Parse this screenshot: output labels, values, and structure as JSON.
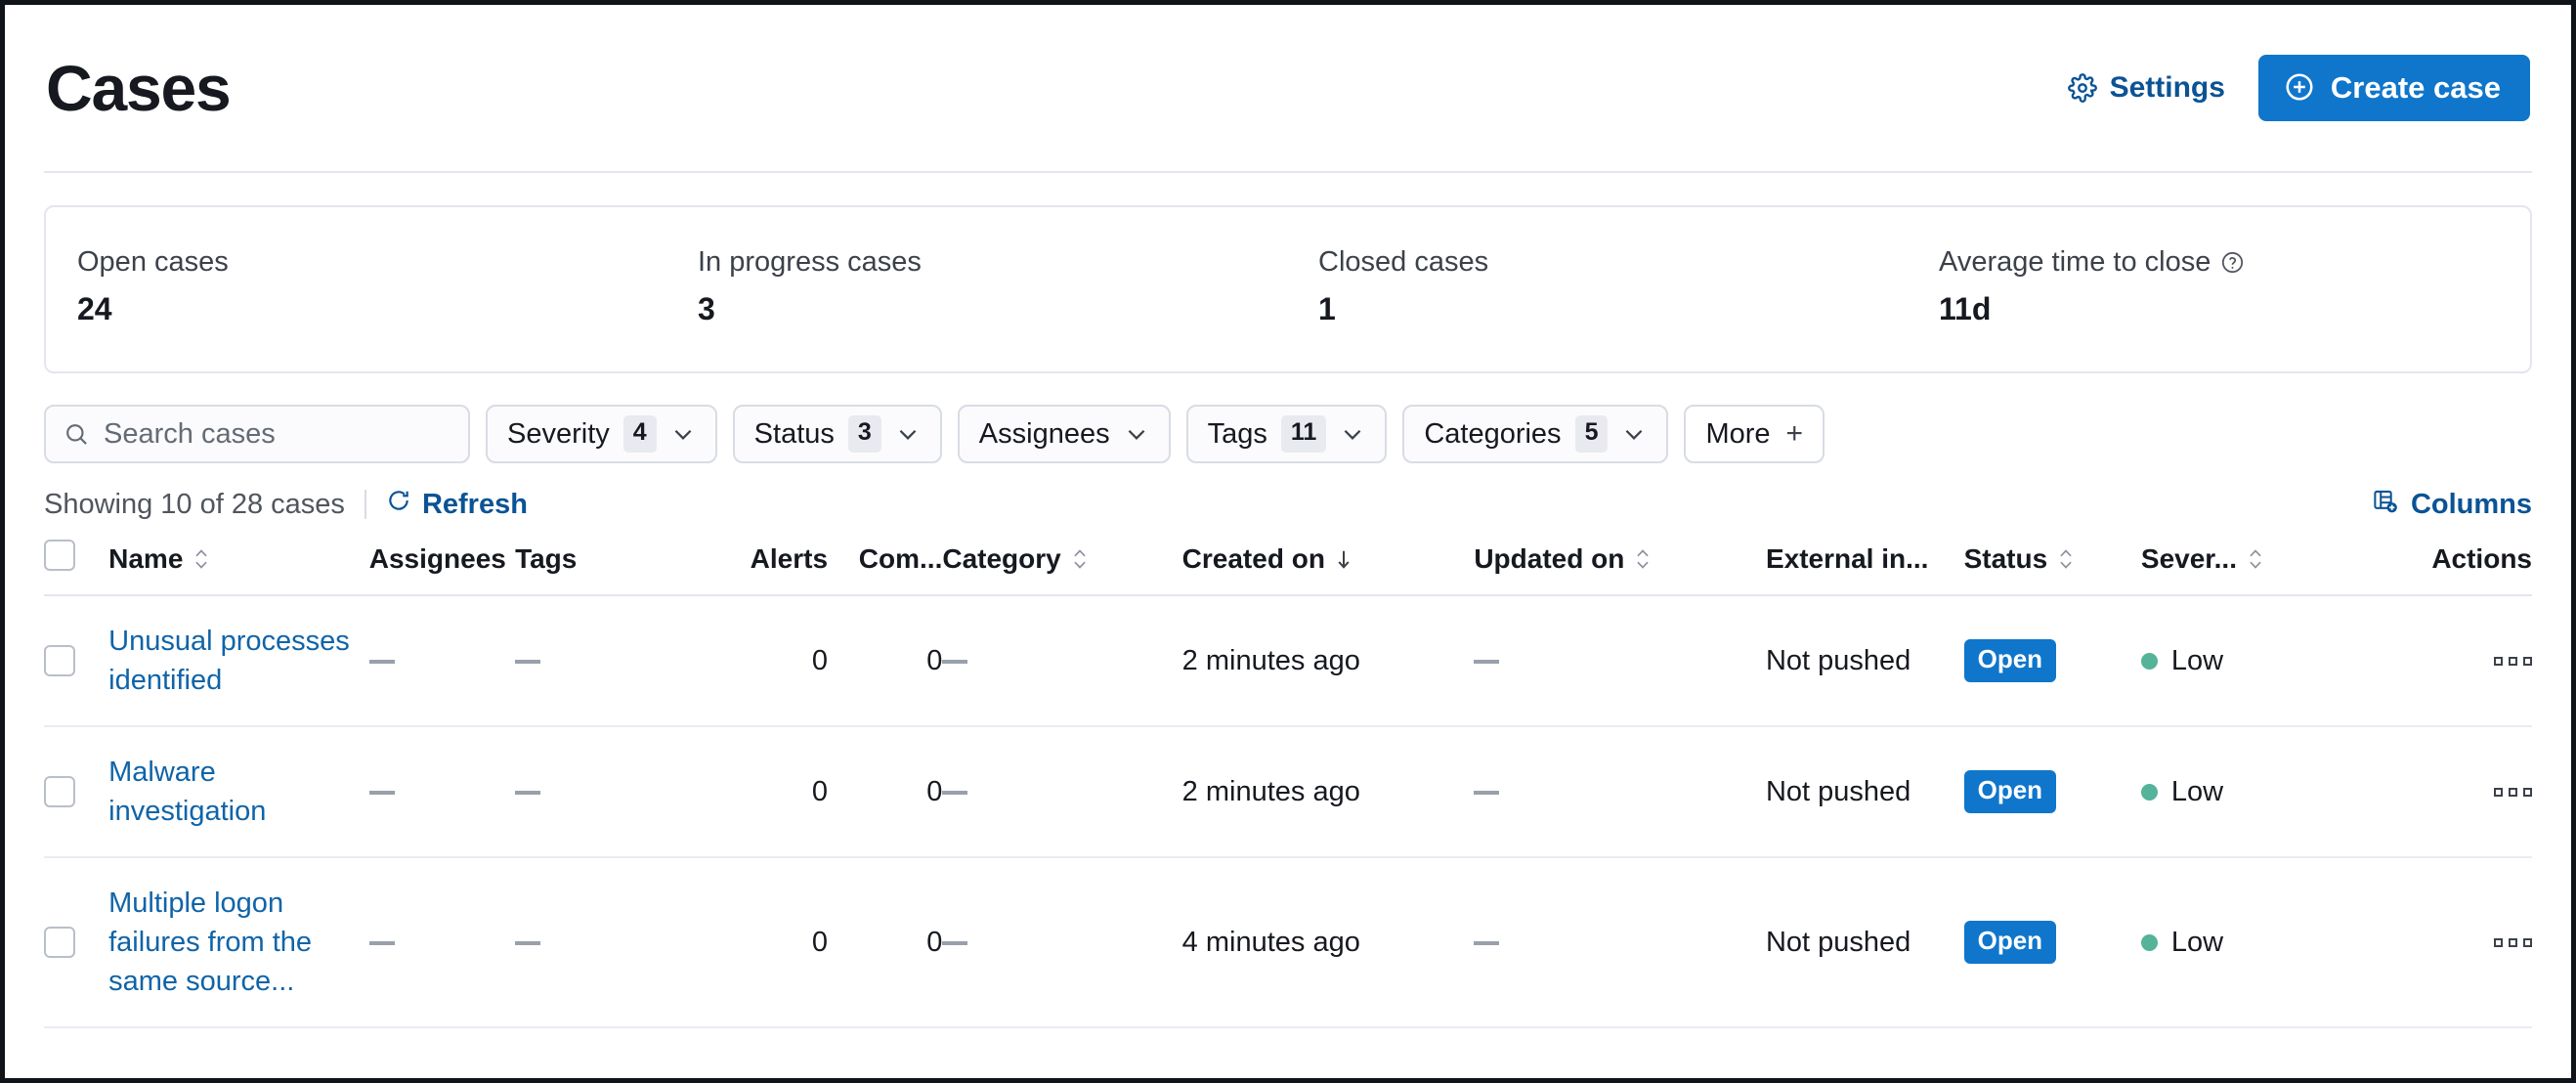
{
  "header": {
    "title": "Cases",
    "settings_label": "Settings",
    "settings_icon": "gear-icon",
    "create_label": "Create case",
    "create_icon": "plus-circle-icon",
    "accent_blue": "#0f76cb",
    "link_blue": "#0b5394"
  },
  "stats": [
    {
      "label": "Open cases",
      "value": "24",
      "has_help": false
    },
    {
      "label": "In progress cases",
      "value": "3",
      "has_help": false
    },
    {
      "label": "Closed cases",
      "value": "1",
      "has_help": false
    },
    {
      "label": "Average time to close",
      "value": "11d",
      "has_help": true
    }
  ],
  "filters": {
    "search": {
      "placeholder": "Search cases",
      "value": "",
      "icon": "search-icon"
    },
    "pills": [
      {
        "label": "Severity",
        "count": "4",
        "chevron": true,
        "plus": false
      },
      {
        "label": "Status",
        "count": "3",
        "chevron": true,
        "plus": false
      },
      {
        "label": "Assignees",
        "count": "",
        "chevron": true,
        "plus": false
      },
      {
        "label": "Tags",
        "count": "11",
        "chevron": true,
        "plus": false
      },
      {
        "label": "Categories",
        "count": "5",
        "chevron": true,
        "plus": false
      },
      {
        "label": "More",
        "count": "",
        "chevron": false,
        "plus": true
      }
    ]
  },
  "toolbar": {
    "showing_text": "Showing 10 of 28 cases",
    "refresh_label": "Refresh",
    "refresh_icon": "refresh-icon",
    "columns_label": "Columns",
    "columns_icon": "columns-add-icon"
  },
  "table": {
    "columns": [
      {
        "key": "check",
        "label": "",
        "sort": "none",
        "align": "left"
      },
      {
        "key": "name",
        "label": "Name",
        "sort": "both",
        "align": "left"
      },
      {
        "key": "assign",
        "label": "Assignees",
        "sort": "none",
        "align": "left"
      },
      {
        "key": "tags",
        "label": "Tags",
        "sort": "none",
        "align": "left"
      },
      {
        "key": "alerts",
        "label": "Alerts",
        "sort": "none",
        "align": "right"
      },
      {
        "key": "com",
        "label": "Com...",
        "sort": "none",
        "align": "right"
      },
      {
        "key": "cat",
        "label": "Category",
        "sort": "both",
        "align": "left"
      },
      {
        "key": "created",
        "label": "Created on",
        "sort": "desc",
        "align": "left"
      },
      {
        "key": "updated",
        "label": "Updated on",
        "sort": "both",
        "align": "left"
      },
      {
        "key": "ext",
        "label": "External in...",
        "sort": "none",
        "align": "left"
      },
      {
        "key": "status",
        "label": "Status",
        "sort": "both",
        "align": "left"
      },
      {
        "key": "sev",
        "label": "Sever...",
        "sort": "both",
        "align": "left"
      },
      {
        "key": "actions",
        "label": "Actions",
        "sort": "none",
        "align": "right"
      }
    ],
    "rows": [
      {
        "name": "Unusual processes identified",
        "assignees": "—",
        "tags": "—",
        "alerts": "0",
        "comments": "0",
        "category": "—",
        "created_on": "2 minutes ago",
        "updated_on": "—",
        "external_incident": "Not pushed",
        "status": "Open",
        "severity": "Low",
        "severity_color": "#54b399"
      },
      {
        "name": "Malware investigation",
        "assignees": "—",
        "tags": "—",
        "alerts": "0",
        "comments": "0",
        "category": "—",
        "created_on": "2 minutes ago",
        "updated_on": "—",
        "external_incident": "Not pushed",
        "status": "Open",
        "severity": "Low",
        "severity_color": "#54b399"
      },
      {
        "name": "Multiple logon failures from the same source...",
        "assignees": "—",
        "tags": "—",
        "alerts": "0",
        "comments": "0",
        "category": "—",
        "created_on": "4 minutes ago",
        "updated_on": "—",
        "external_incident": "Not pushed",
        "status": "Open",
        "severity": "Low",
        "severity_color": "#54b399"
      }
    ]
  }
}
